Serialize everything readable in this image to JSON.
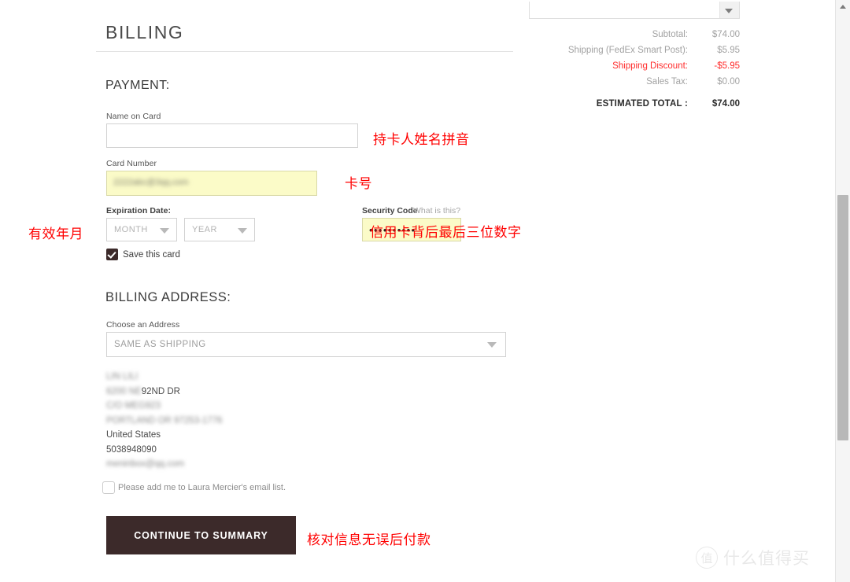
{
  "page": {
    "billing_title": "BILLING"
  },
  "payment": {
    "section_title": "PAYMENT:",
    "name_on_card": {
      "label": "Name on Card",
      "value": "",
      "placeholder": ""
    },
    "card_number": {
      "label": "Card Number",
      "value": "",
      "blurred_value": "2222abc@3qq.com"
    },
    "expiration": {
      "label": "Expiration Date:",
      "month_value": "MONTH",
      "year_value": "YEAR"
    },
    "security_code": {
      "label": "Security Code",
      "help_link": "What is this?",
      "value": "••••••••••"
    },
    "save_card": {
      "label": "Save this card",
      "checked": true
    }
  },
  "billing_address": {
    "section_title": "BILLING ADDRESS:",
    "choose_label": "Choose an Address",
    "selected_address": "SAME AS SHIPPING",
    "address_lines": [
      {
        "text": "LIN LILI",
        "blurred": true
      },
      {
        "blurred_part": "6200 NE ",
        "clear_part": "92ND DR",
        "blurred": "mixed"
      },
      {
        "text": "C/O MEG923",
        "blurred": true
      },
      {
        "text": "PORTLAND  OR  97253-1776",
        "blurred": true
      },
      {
        "text": "United States",
        "blurred": false
      },
      {
        "text": "5038948090",
        "blurred": false
      },
      {
        "text": "meninbox@qq.com",
        "blurred": true
      }
    ],
    "email_optin": {
      "label": "Please add me to Laura Mercier's email list.",
      "checked": false
    },
    "continue_button": "CONTINUE TO SUMMARY"
  },
  "summary": {
    "rows": [
      {
        "label": "Subtotal:",
        "value": "$74.00"
      },
      {
        "label": "Shipping (FedEx Smart Post):",
        "value": "$5.95"
      },
      {
        "label": "Shipping Discount:",
        "value": "-$5.95"
      },
      {
        "label": "Sales Tax:",
        "value": "$0.00"
      }
    ],
    "total_label": "ESTIMATED TOTAL :",
    "total_value": "$74.00",
    "discount_color": "#ff2b2b"
  },
  "annotations": {
    "name_on_card": "持卡人姓名拼音",
    "card_number": "卡号",
    "expiration": "有效年月",
    "security_code": "信用卡背后最后三位数字",
    "pay": "核对信息无误后付款"
  },
  "watermark": {
    "logo_char": "值",
    "text": "什么值得买"
  }
}
